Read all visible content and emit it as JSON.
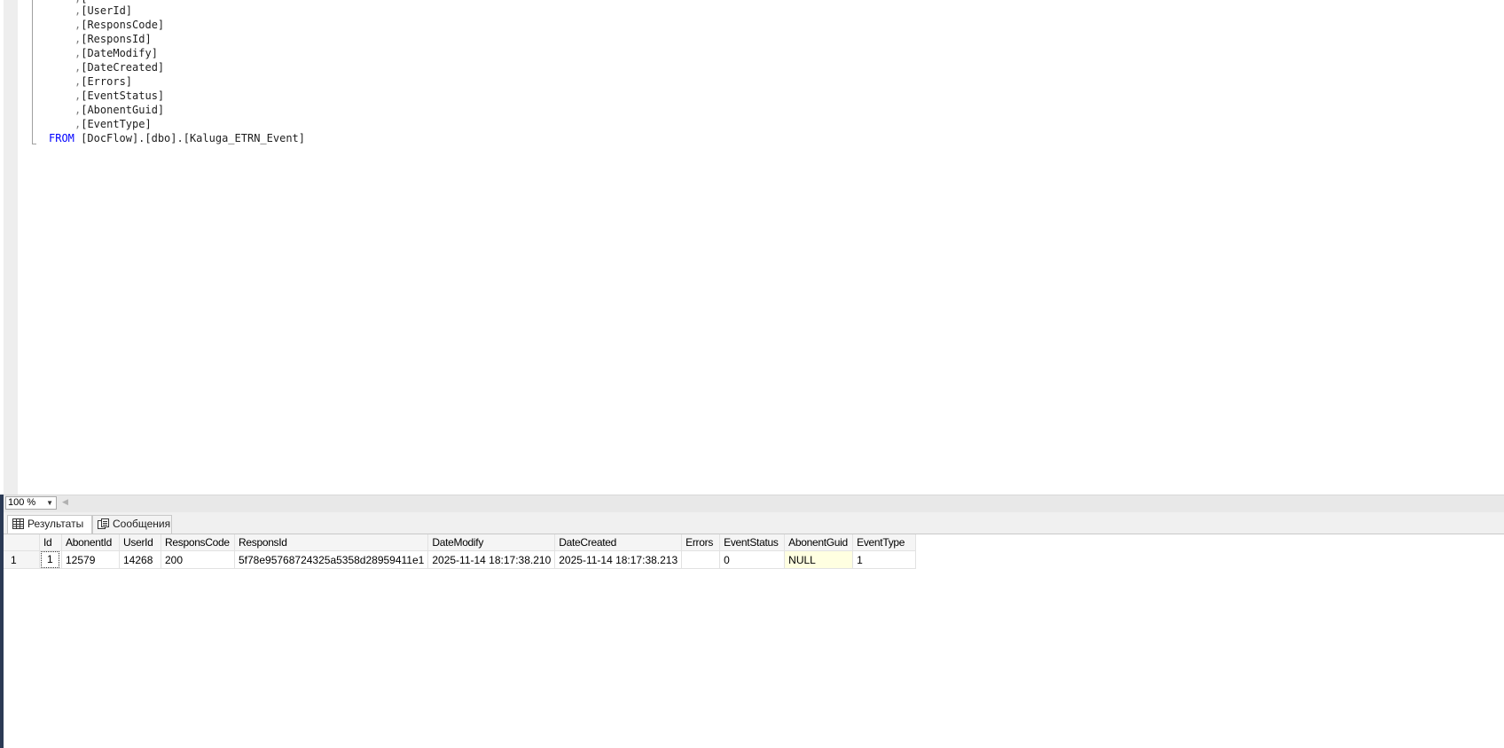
{
  "editor": {
    "select_columns": [
      "[UserId]",
      "[ResponsCode]",
      "[ResponsId]",
      "[DateModify]",
      "[DateCreated]",
      "[Errors]",
      "[EventStatus]",
      "[AbonentGuid]",
      "[EventType]"
    ],
    "from_keyword": "FROM",
    "from_table": "[DocFlow].[dbo].[Kaluga_ETRN_Event]",
    "comma": ","
  },
  "status": {
    "zoom": "100 %"
  },
  "tabs": {
    "results": "Результаты",
    "messages": "Сообщения"
  },
  "grid": {
    "headers": [
      "Id",
      "AbonentId",
      "UserId",
      "ResponsCode",
      "ResponsId",
      "DateModify",
      "DateCreated",
      "Errors",
      "EventStatus",
      "AbonentGuid",
      "EventType"
    ],
    "rows": [
      {
        "rownum": "1",
        "cells": [
          "1",
          "12579",
          "14268",
          "200",
          "5f78e95768724325a5358d28959411e1",
          "2025-11-14 18:17:38.210",
          "2025-11-14 18:17:38.213",
          "",
          "0",
          "NULL",
          "1"
        ]
      }
    ]
  },
  "colors": {
    "keyword": "#0000ff",
    "null_cell_bg": "#ffffe1"
  }
}
